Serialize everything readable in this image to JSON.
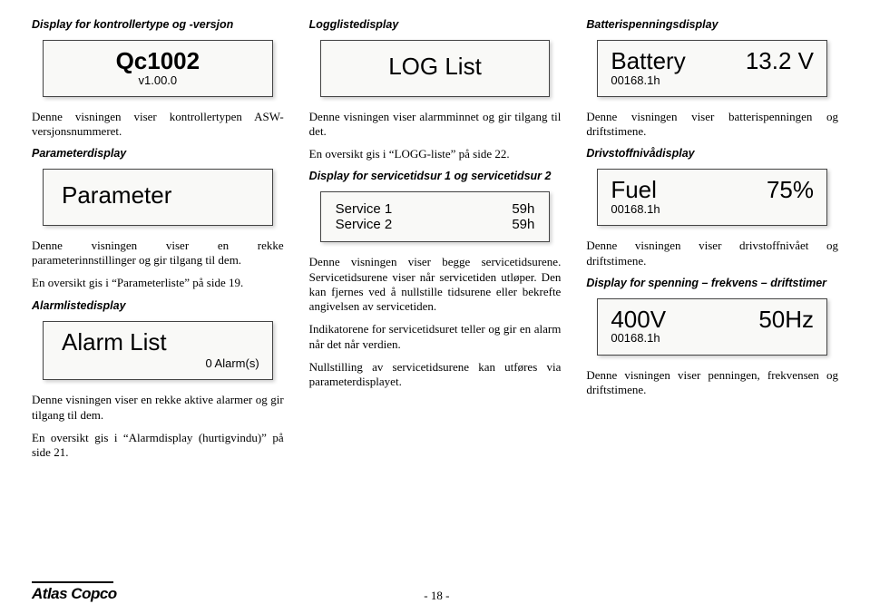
{
  "col1": {
    "h1": "Display for kontrollertype og -versjon",
    "box1_line1": "Qc1002",
    "box1_line2": "v1.00.0",
    "p1": "Denne visningen viser kontrollertypen ASW-versjonsnummeret.",
    "h2": "Parameterdisplay",
    "box2_line1": "Parameter",
    "p2": "Denne visningen viser en rekke parameterinnstillinger og gir tilgang til dem.",
    "p3": "En oversikt gis i “Parameterliste” på side 19.",
    "h3": "Alarmlistedisplay",
    "box3_line1": "Alarm List",
    "box3_count": "0 Alarm(s)",
    "p4": "Denne visningen viser en rekke aktive alarmer og gir tilgang til dem.",
    "p5": "En oversikt gis i “Alarmdisplay (hurtigvindu)” på side 21."
  },
  "col2": {
    "h1": "Logglistedisplay",
    "box1_line1": "LOG List",
    "p1": "Denne visningen viser alarmminnet og gir tilgang til det.",
    "p2": "En oversikt gis i “LOGG-liste” på side 22.",
    "h2": "Display for servicetidsur 1 og servicetidsur 2",
    "box2_s1_label": "Service 1",
    "box2_s1_val": "59h",
    "box2_s2_label": "Service 2",
    "box2_s2_val": "59h",
    "p3": "Denne visningen viser begge servicetidsurene. Servicetidsurene viser når servicetiden utløper. Den kan fjernes ved å nullstille tidsurene eller bekrefte angivelsen av servicetiden.",
    "p4": "Indikatorene for servicetidsuret teller og gir en alarm når det når verdien.",
    "p5": "Nullstilling av servicetidsurene kan utføres via parameterdisplayet."
  },
  "col3": {
    "h1": "Batterispenningsdisplay",
    "box1_left": "Battery",
    "box1_right": "13.2 V",
    "box1_sub": "00168.1h",
    "p1": "Denne visningen viser batterispenningen og driftstimene.",
    "h2": "Drivstoffnivådisplay",
    "box2_left": "Fuel",
    "box2_right": "75%",
    "box2_sub": "00168.1h",
    "p2": "Denne visningen viser drivstoffnivået og driftstimene.",
    "h3": "Display for spenning – frekvens – driftstimer",
    "box3_left": "400V",
    "box3_right": "50Hz",
    "box3_sub": "00168.1h",
    "p3": "Denne visningen viser penningen, frekvensen og driftstimene."
  },
  "footer": {
    "logo": "Atlas Copco",
    "page": "- 18 -"
  }
}
